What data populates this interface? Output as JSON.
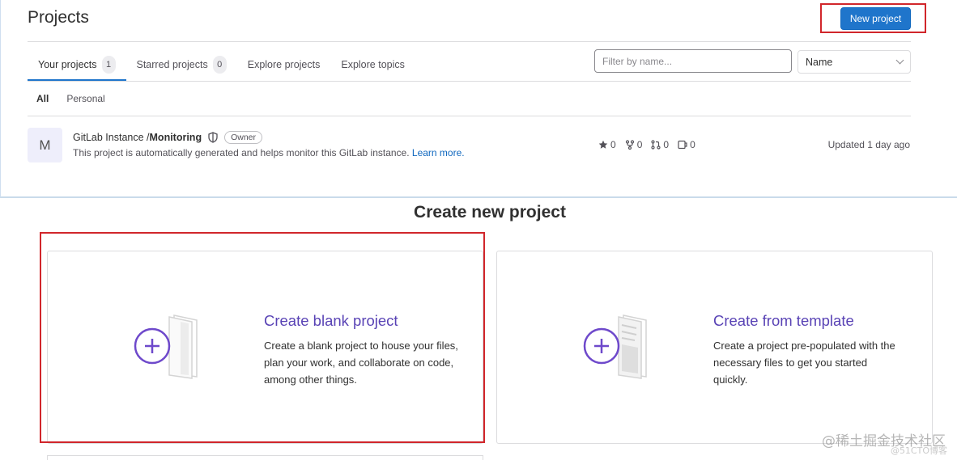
{
  "header": {
    "title": "Projects",
    "new_project_label": "New project"
  },
  "tabs": [
    {
      "label": "Your projects",
      "count": "1"
    },
    {
      "label": "Starred projects",
      "count": "0"
    },
    {
      "label": "Explore projects"
    },
    {
      "label": "Explore topics"
    }
  ],
  "filter": {
    "placeholder": "Filter by name...",
    "sort_value": "Name"
  },
  "subtabs": [
    "All",
    "Personal"
  ],
  "project": {
    "avatar_letter": "M",
    "namespace": "GitLab Instance / ",
    "name": "Monitoring",
    "role": "Owner",
    "description": "This project is automatically generated and helps monitor this GitLab instance.",
    "learn_more": "Learn more.",
    "stars": "0",
    "forks": "0",
    "merge_requests": "0",
    "issues": "0",
    "updated": "Updated 1 day ago"
  },
  "create": {
    "heading": "Create new project",
    "blank": {
      "title": "Create blank project",
      "text": "Create a blank project to house your files, plan your work, and collaborate on code, among other things."
    },
    "template": {
      "title": "Create from template",
      "text": "Create a project pre-populated with the necessary files to get you started quickly."
    }
  },
  "watermark": {
    "main": "@稀土掘金技术社区",
    "sub": "@51CTO博客"
  },
  "colors": {
    "primary": "#1f75cb",
    "highlight": "#d1262b",
    "purple": "#5943b5"
  }
}
